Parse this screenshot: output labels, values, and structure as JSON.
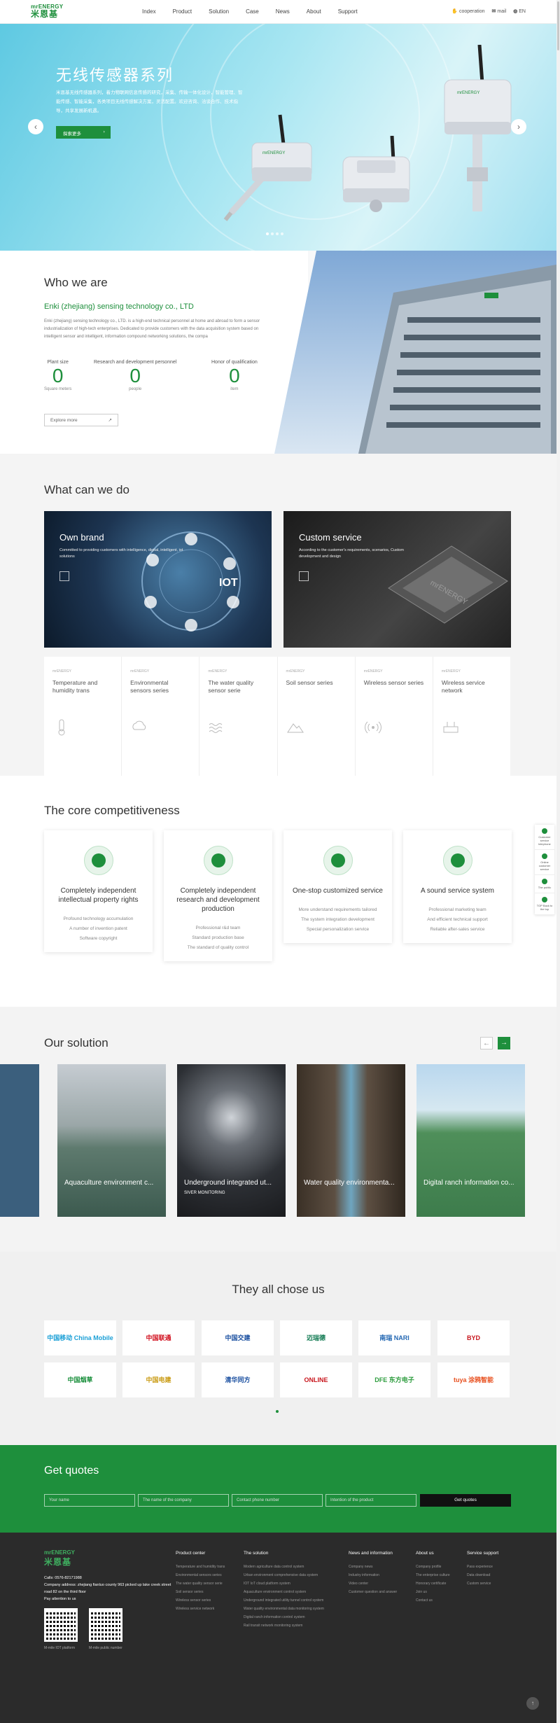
{
  "header": {
    "logo_en": "mrENERGY",
    "logo_cn": "米恩基",
    "nav": [
      "Index",
      "Product",
      "Solution",
      "Case",
      "News",
      "About",
      "Support"
    ],
    "right": [
      "cooperation",
      "mail",
      "EN"
    ]
  },
  "banner": {
    "title": "无线传感器系列",
    "text": "米恩基无线传感器系列，着力物联网信息传感的研究，采集、传输一体化设计，智能管理、智能传感、智能采集，各类项目无线传感解决方案，灵活配置。欢迎咨询、洽谈合作、技术指导，共享发展新机遇。",
    "button": "探索更多",
    "prev": "‹",
    "next": "›",
    "slides": 4,
    "active_slide": 1
  },
  "who": {
    "heading": "Who we are",
    "company": "Enki (zhejiang) sensing technology co., LTD",
    "desc": "Enki (zhejiang) sensing technology co., LTD. is a high-end technical personnel at home and abroad to form a sensor industrialization of high-tech enterprises. Dedicated to provide customers with the data acquisition system based on intelligent sensor and intelligent, information compound networking solutions, the compa",
    "stats": [
      {
        "title": "Plant size",
        "value": "0",
        "unit": "Square meters"
      },
      {
        "title": "Research and development personnel",
        "value": "0",
        "unit": "people"
      },
      {
        "title": "Honor of qualification",
        "value": "0",
        "unit": "item"
      }
    ],
    "more": "Explore more",
    "more_icon": "↗"
  },
  "what": {
    "heading": "What can we do",
    "cards": [
      {
        "title": "Own brand",
        "text": "Committed to providing customers with intelligence, digital, intelligent, iot solutions"
      },
      {
        "title": "Custom service",
        "text": "According to the customer's requirements, scenarios, Custom development and design"
      }
    ],
    "products": [
      {
        "kicker": "mrENERGY",
        "name": "Temperature and humidity trans",
        "icon": "thermometer-icon"
      },
      {
        "kicker": "mrENERGY",
        "name": "Environmental sensors series",
        "icon": "cloud-icon"
      },
      {
        "kicker": "mrENERGY",
        "name": "The water quality sensor serie",
        "icon": "water-icon"
      },
      {
        "kicker": "mrENERGY",
        "name": "Soil sensor series",
        "icon": "soil-icon"
      },
      {
        "kicker": "mrENERGY",
        "name": "Wireless sensor series",
        "icon": "wireless-icon"
      },
      {
        "kicker": "mrENERGY",
        "name": "Wireless service network",
        "icon": "router-icon"
      }
    ]
  },
  "core": {
    "heading": "The core competitiveness",
    "items": [
      {
        "title": "Completely independent intellectual property rights",
        "lines": [
          "Profound technology accumulation",
          "A number of invention patent",
          "Software copyright"
        ],
        "icon": "patent-icon"
      },
      {
        "title": "Completely independent research and development production",
        "lines": [
          "Professional r&d team",
          "Standard production base",
          "The standard of quality control"
        ],
        "icon": "tools-icon"
      },
      {
        "title": "One-stop customized service",
        "lines": [
          "More understand requirements tailored",
          "The system integration development",
          "Special personalization service"
        ],
        "icon": "service-icon"
      },
      {
        "title": "A sound service system",
        "lines": [
          "Professional marketing team",
          "And efficient technical support",
          "Reliable after-sales service"
        ],
        "icon": "network-icon"
      }
    ]
  },
  "solution": {
    "heading": "Our solution",
    "prev": "←",
    "next": "→",
    "cards": [
      {
        "title": "Aquaculture environment c...",
        "sub": ""
      },
      {
        "title": "Underground integrated ut...",
        "sub": "SIVER MONITORING"
      },
      {
        "title": "Water quality environmenta...",
        "sub": ""
      },
      {
        "title": "Digital ranch information co...",
        "sub": ""
      }
    ]
  },
  "chose": {
    "heading": "They all chose us",
    "logos": [
      "中国移动 China Mobile",
      "中国联通",
      "中国交建",
      "迈瑞德",
      "南瑞 NARI",
      "BYD",
      "中国烟草",
      "中国电建",
      "清华同方",
      "ONLINE",
      "DFE 东方电子",
      "tuya 涂鸦智能"
    ]
  },
  "quotes": {
    "heading": "Get quotes",
    "placeholders": [
      "Your name",
      "The name of the company",
      "Contact phone number",
      "Intention of the product"
    ],
    "button": "Get quotes"
  },
  "footer": {
    "logo_en": "mrENERGY",
    "logo_cn": "米恩基",
    "calls": "Calls: 0576-82171988",
    "address": "Company address: zhejiang fianluo county 963 picked up lake creek street road 82 on the third floor",
    "follow": "Pay attention to us",
    "qr_labels": [
      "M-mile IOT platform",
      "M-mile public number"
    ],
    "columns": [
      {
        "head": "Product center",
        "items": [
          "Temperature and humidity trans",
          "Environmental sensors series",
          "The water quality sensor serie",
          "Soil sensor series",
          "Wireless sensor series",
          "Wireless service network"
        ]
      },
      {
        "head": "The solution",
        "items": [
          "Modern agriculture data control system",
          "Urban environment comprehensive data system",
          "IOT IoT cloud platform system",
          "Aquaculture environment control system",
          "Underground integrated utility tunnel control system",
          "Water quality environmental data monitoring system",
          "Digital ranch information control system",
          "Rail transit network monitoring system"
        ]
      },
      {
        "head": "News and information",
        "items": [
          "Company news",
          "Industry information",
          "Video center",
          "Customer question and answer"
        ]
      },
      {
        "head": "About us",
        "items": [
          "Company profile",
          "The enterprise culture",
          "Honorary certificate",
          "Join us",
          "Contact us"
        ]
      },
      {
        "head": "Service support",
        "items": [
          "Pass experience",
          "Data download",
          "Custom service"
        ]
      }
    ],
    "totop": "↑"
  },
  "side": [
    "Customer service telephone",
    "Online customer service",
    "The public",
    "TOP Back to the top"
  ]
}
